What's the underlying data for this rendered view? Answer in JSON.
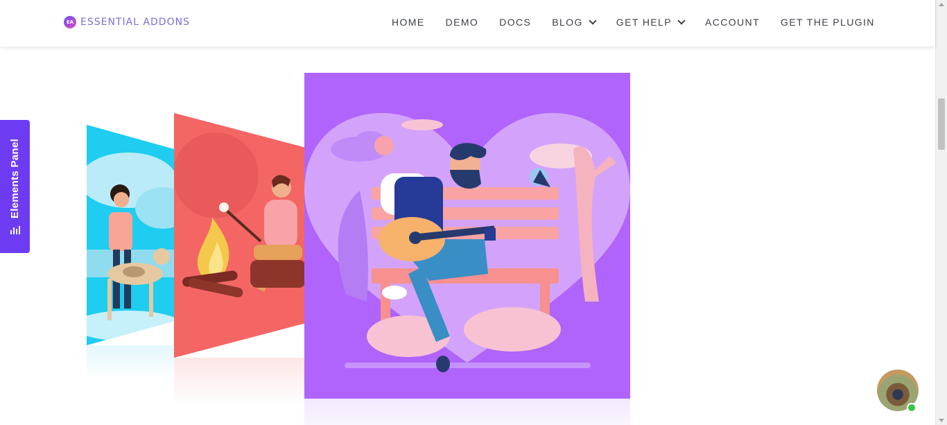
{
  "brand": {
    "mark": "EA",
    "name": "ESSENTIAL ADDONS"
  },
  "nav": [
    {
      "label": "HOME"
    },
    {
      "label": "DEMO"
    },
    {
      "label": "DOCS"
    },
    {
      "label": "BLOG"
    },
    {
      "label": "GET HELP"
    },
    {
      "label": "ACCOUNT"
    },
    {
      "label": "GET THE PLUGIN"
    }
  ],
  "elements_panel": {
    "label": "Elements Panel"
  },
  "colors": {
    "accent": "#6d3cf2",
    "slide_main": "#b064fb",
    "slide_mid": "#f46664",
    "slide_left": "#1ecdf0",
    "online": "#3ac34a"
  }
}
